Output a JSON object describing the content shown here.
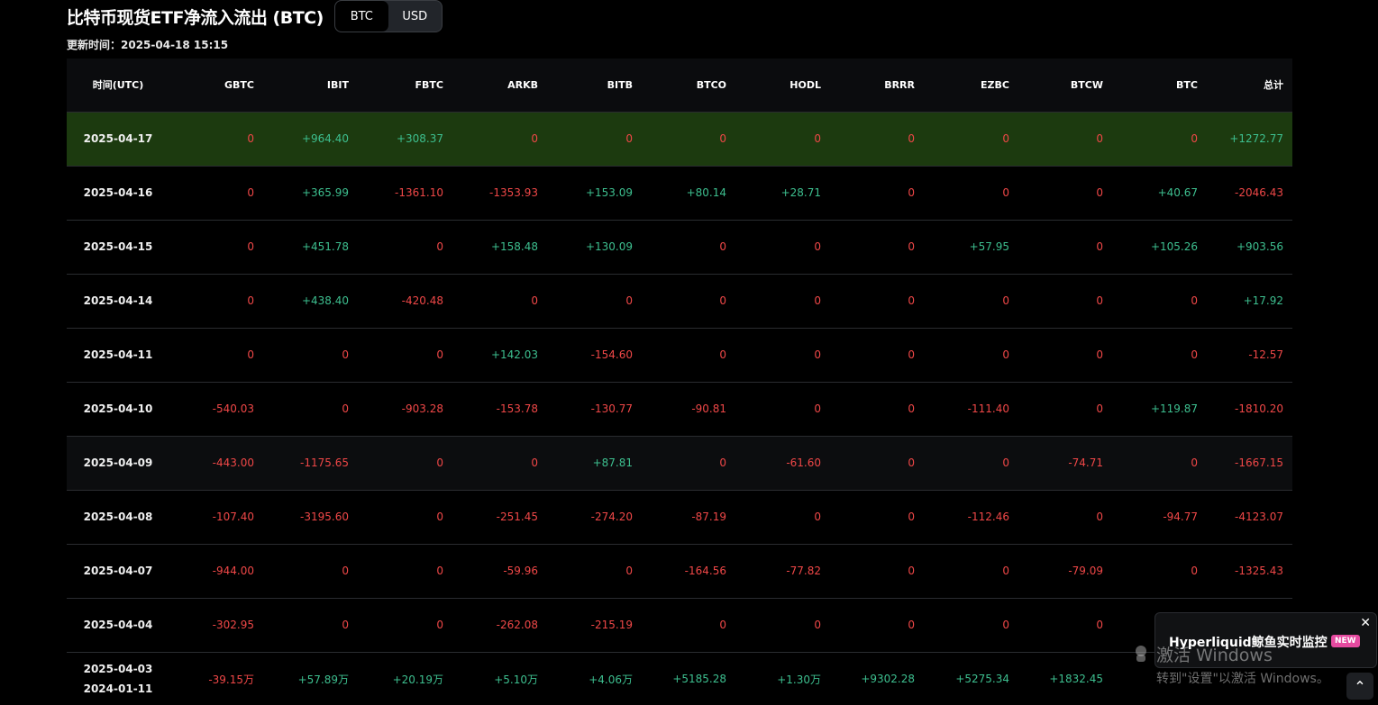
{
  "header": {
    "title": "比特币现货ETF净流入流出 (BTC)",
    "toggle": [
      "BTC",
      "USD"
    ],
    "active_toggle": "BTC",
    "updated": "更新时间：2025-04-18 15:15"
  },
  "table": {
    "columns": [
      "时间(UTC)",
      "GBTC",
      "IBIT",
      "FBTC",
      "ARKB",
      "BITB",
      "BTCO",
      "HODL",
      "BRRR",
      "EZBC",
      "BTCW",
      "BTC",
      "总计"
    ],
    "rows": [
      {
        "date": "2025-04-17",
        "values": [
          "0",
          "+964.40",
          "+308.37",
          "0",
          "0",
          "0",
          "0",
          "0",
          "0",
          "0",
          "0",
          "+1272.77"
        ]
      },
      {
        "date": "2025-04-16",
        "values": [
          "0",
          "+365.99",
          "-1361.10",
          "-1353.93",
          "+153.09",
          "+80.14",
          "+28.71",
          "0",
          "0",
          "0",
          "+40.67",
          "-2046.43"
        ]
      },
      {
        "date": "2025-04-15",
        "values": [
          "0",
          "+451.78",
          "0",
          "+158.48",
          "+130.09",
          "0",
          "0",
          "0",
          "+57.95",
          "0",
          "+105.26",
          "+903.56"
        ]
      },
      {
        "date": "2025-04-14",
        "values": [
          "0",
          "+438.40",
          "-420.48",
          "0",
          "0",
          "0",
          "0",
          "0",
          "0",
          "0",
          "0",
          "+17.92"
        ]
      },
      {
        "date": "2025-04-11",
        "values": [
          "0",
          "0",
          "0",
          "+142.03",
          "-154.60",
          "0",
          "0",
          "0",
          "0",
          "0",
          "0",
          "-12.57"
        ]
      },
      {
        "date": "2025-04-10",
        "values": [
          "-540.03",
          "0",
          "-903.28",
          "-153.78",
          "-130.77",
          "-90.81",
          "0",
          "0",
          "-111.40",
          "0",
          "+119.87",
          "-1810.20"
        ]
      },
      {
        "date": "2025-04-09",
        "values": [
          "-443.00",
          "-1175.65",
          "0",
          "0",
          "+87.81",
          "0",
          "-61.60",
          "0",
          "0",
          "-74.71",
          "0",
          "-1667.15"
        ]
      },
      {
        "date": "2025-04-08",
        "values": [
          "-107.40",
          "-3195.60",
          "0",
          "-251.45",
          "-274.20",
          "-87.19",
          "0",
          "0",
          "-112.46",
          "0",
          "-94.77",
          "-4123.07"
        ]
      },
      {
        "date": "2025-04-07",
        "values": [
          "-944.00",
          "0",
          "0",
          "-59.96",
          "0",
          "-164.56",
          "-77.82",
          "0",
          "0",
          "-79.09",
          "0",
          "-1325.43"
        ]
      },
      {
        "date": "2025-04-04",
        "values": [
          "-302.95",
          "0",
          "0",
          "-262.08",
          "-215.19",
          "0",
          "0",
          "0",
          "0",
          "0",
          "",
          ""
        ]
      },
      {
        "date": "2025-04-03",
        "date2": "2024-01-11",
        "values": [
          "-39.15万",
          "+57.89万",
          "+20.19万",
          "+5.10万",
          "+4.06万",
          "+5185.28",
          "+1.30万",
          "+9302.28",
          "+5275.34",
          "+1832.45",
          "",
          ""
        ]
      }
    ]
  },
  "popup": {
    "text": "Hyperliquid鲸鱼实时监控",
    "badge": "NEW",
    "close": "✕"
  },
  "watermark": {
    "line1": "激活 Windows",
    "line2": "转到\"设置\"以激活 Windows。"
  },
  "scroll_top": "⌃",
  "colors": {
    "positive": "#3dbf8f",
    "negative": "#ef4747",
    "highlight_row": "#1c3a0f"
  }
}
